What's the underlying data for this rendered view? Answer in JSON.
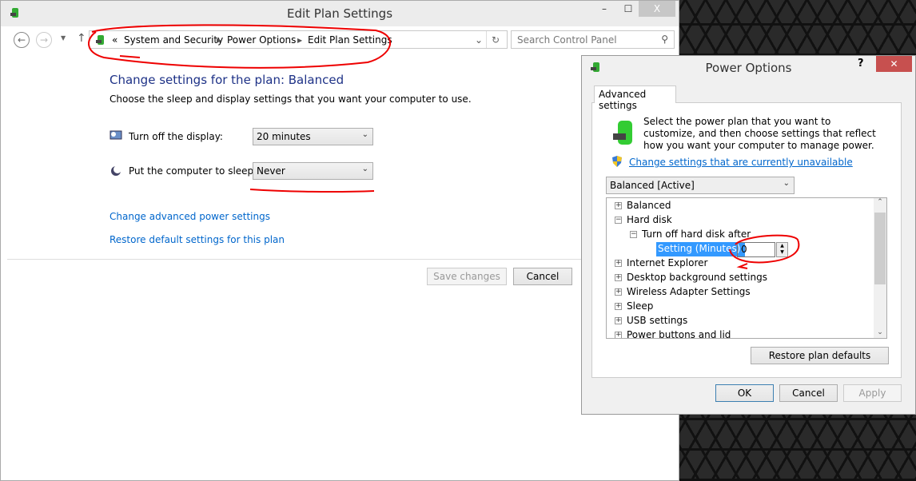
{
  "main_window": {
    "title": "Edit Plan Settings",
    "minimize": "–",
    "maximize": "☐",
    "close": "X",
    "breadcrumb": {
      "prefix": "«",
      "items": [
        "System and Security",
        "Power Options",
        "Edit Plan Settings"
      ]
    },
    "search_placeholder": "Search Control Panel",
    "heading": "Change settings for the plan: Balanced",
    "subheading": "Choose the sleep and display settings that you want your computer to use.",
    "display_label": "Turn off the display:",
    "display_value": "20 minutes",
    "sleep_label": "Put the computer to sleep:",
    "sleep_value": "Never",
    "advanced_link": "Change advanced power settings",
    "restore_link": "Restore default settings for this plan",
    "save_button": "Save changes",
    "cancel_button": "Cancel"
  },
  "dialog": {
    "title": "Power Options",
    "help": "?",
    "close": "✕",
    "tab": "Advanced settings",
    "description": "Select the power plan that you want to customize, and then choose settings that reflect how you want your computer to manage power.",
    "change_link": "Change settings that are currently unavailable",
    "plan_select": "Balanced [Active]",
    "tree": [
      {
        "label": "Balanced",
        "state": "+"
      },
      {
        "label": "Hard disk",
        "state": "−"
      },
      {
        "label": "Turn off hard disk after",
        "state": "−"
      },
      {
        "label": "Setting (Minutes):",
        "value": "0"
      },
      {
        "label": "Internet Explorer",
        "state": "+"
      },
      {
        "label": "Desktop background settings",
        "state": "+"
      },
      {
        "label": "Wireless Adapter Settings",
        "state": "+"
      },
      {
        "label": "Sleep",
        "state": "+"
      },
      {
        "label": "USB settings",
        "state": "+"
      },
      {
        "label": "Power buttons and lid",
        "state": "+"
      }
    ],
    "restore_button": "Restore plan defaults",
    "ok": "OK",
    "cancel": "Cancel",
    "apply": "Apply"
  },
  "colors": {
    "link": "#0066cc",
    "heading": "#1e3287",
    "selection": "#3399ff",
    "annotation": "#e00000"
  }
}
